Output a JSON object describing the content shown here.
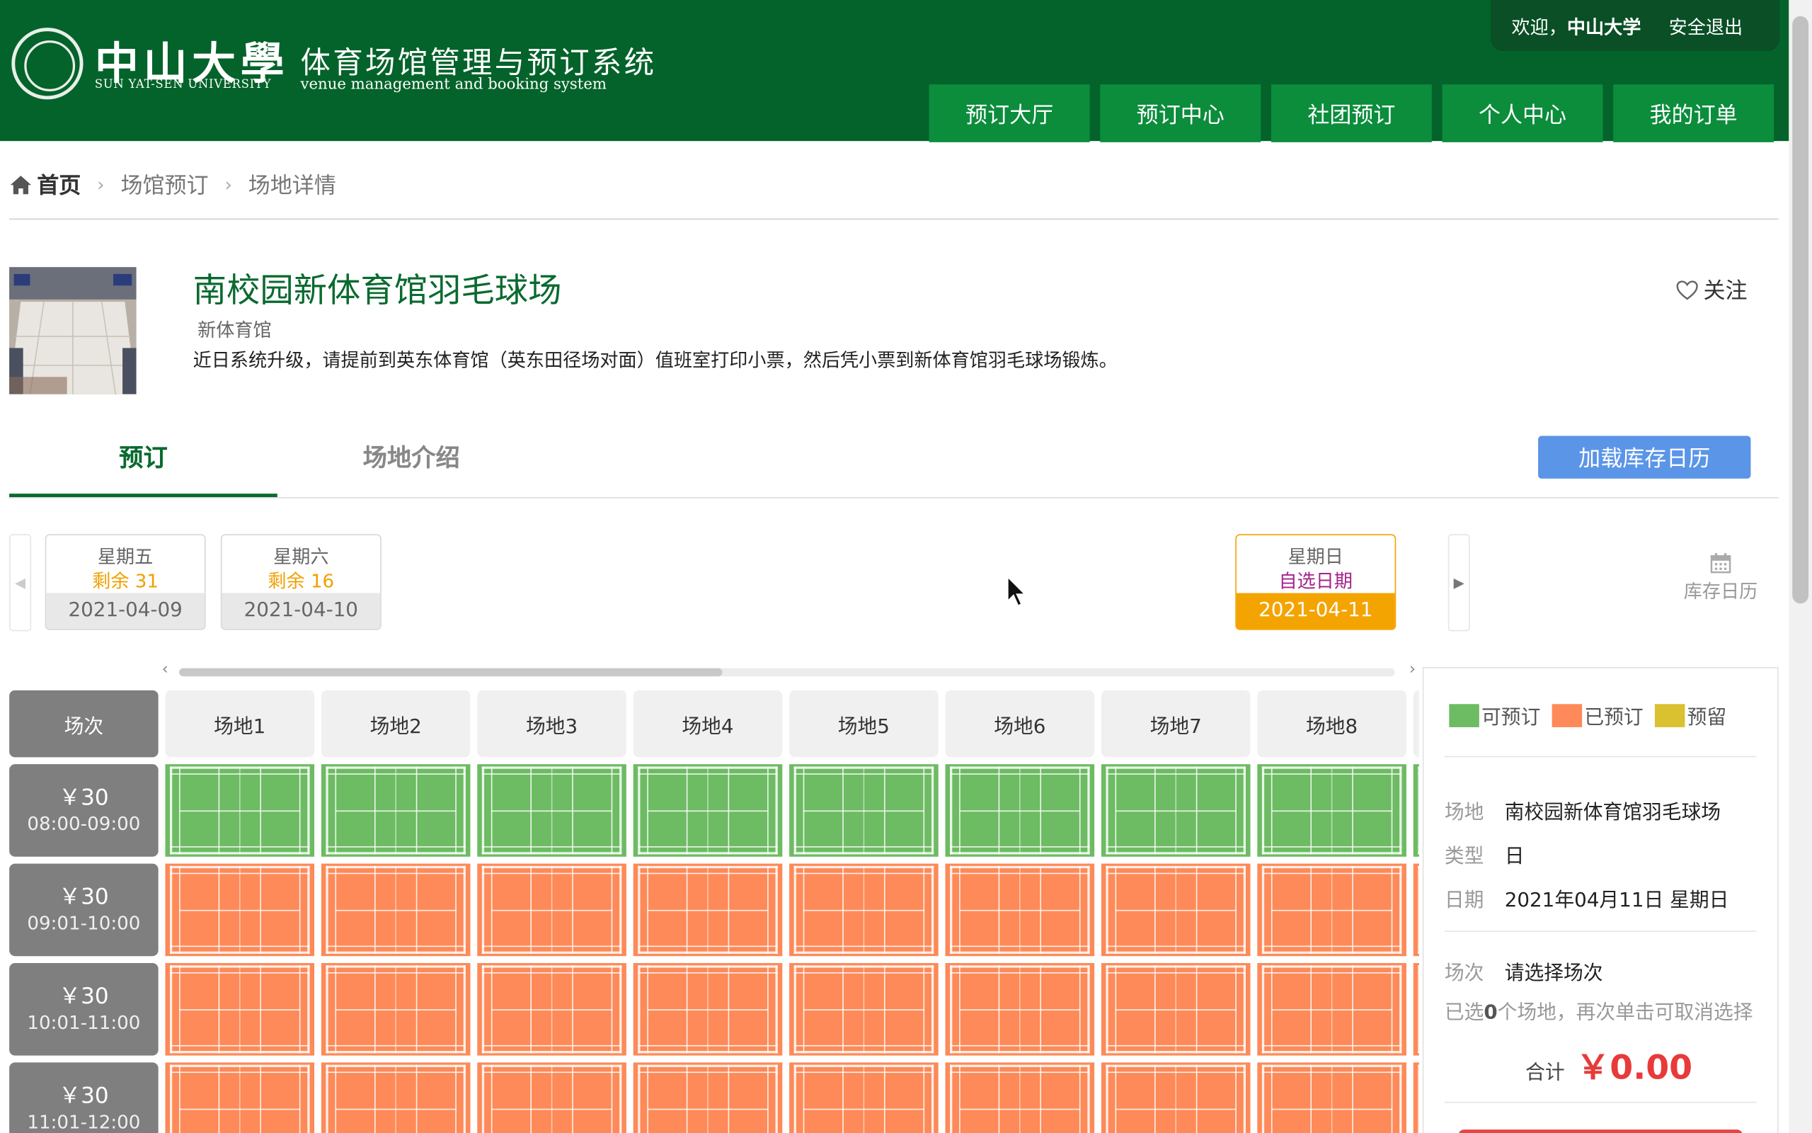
{
  "header": {
    "logo_cn": "中山大學",
    "logo_en": "SUN YAT-SEN UNIVERSITY",
    "system_cn": "体育场馆管理与预订系统",
    "system_en": "venue management and booking system",
    "welcome": "欢迎，",
    "username": "中山大学",
    "logout": "安全退出",
    "nav": [
      "预订大厅",
      "预订中心",
      "社团预订",
      "个人中心",
      "我的订单"
    ]
  },
  "breadcrumb": {
    "home": "首页",
    "items": [
      "场馆预订",
      "场地详情"
    ]
  },
  "venue": {
    "title": "南校园新体育馆羽毛球场",
    "subtitle": "新体育馆",
    "notice": "近日系统升级，请提前到英东体育馆（英东田径场对面）值班室打印小票，然后凭小票到新体育馆羽毛球场锻炼。",
    "follow": "关注"
  },
  "tabs": {
    "book": "预订",
    "intro": "场地介绍",
    "load_calendar": "加载库存日历"
  },
  "dates": [
    {
      "weekday": "星期五",
      "status": "剩余 31",
      "date": "2021-04-09",
      "selected": false
    },
    {
      "weekday": "星期六",
      "status": "剩余 16",
      "date": "2021-04-10",
      "selected": false
    },
    {
      "weekday": "星期日",
      "status": "自选日期",
      "date": "2021-04-11",
      "selected": true
    }
  ],
  "calendar_link": "库存日历",
  "grid": {
    "corner": "场次",
    "courts": [
      "场地1",
      "场地2",
      "场地3",
      "场地4",
      "场地5",
      "场地6",
      "场地7",
      "场地8"
    ],
    "slots": [
      {
        "price": "￥30",
        "time": "08:00-09:00",
        "status": "available"
      },
      {
        "price": "￥30",
        "time": "09:01-10:00",
        "status": "booked"
      },
      {
        "price": "￥30",
        "time": "10:01-11:00",
        "status": "booked"
      },
      {
        "price": "￥30",
        "time": "11:01-12:00",
        "status": "booked"
      }
    ]
  },
  "legend": {
    "available": "可预订",
    "booked": "已预订",
    "reserved": "预留",
    "colors": {
      "available": "#6dbb63",
      "booked": "#fd8a58",
      "reserved": "#d9c12f"
    }
  },
  "panel": {
    "venue_label": "场地",
    "venue_value": "南校园新体育馆羽毛球场",
    "type_label": "类型",
    "type_value": "日",
    "date_label": "日期",
    "date_value": "2021年04月11日 星期日",
    "slot_label": "场次",
    "slot_value": "请选择场次",
    "note_prefix": "已选",
    "note_count": "0",
    "note_suffix": "个场地，再次单击可取消选择",
    "total_label": "合计",
    "total_value": "￥0.00"
  }
}
